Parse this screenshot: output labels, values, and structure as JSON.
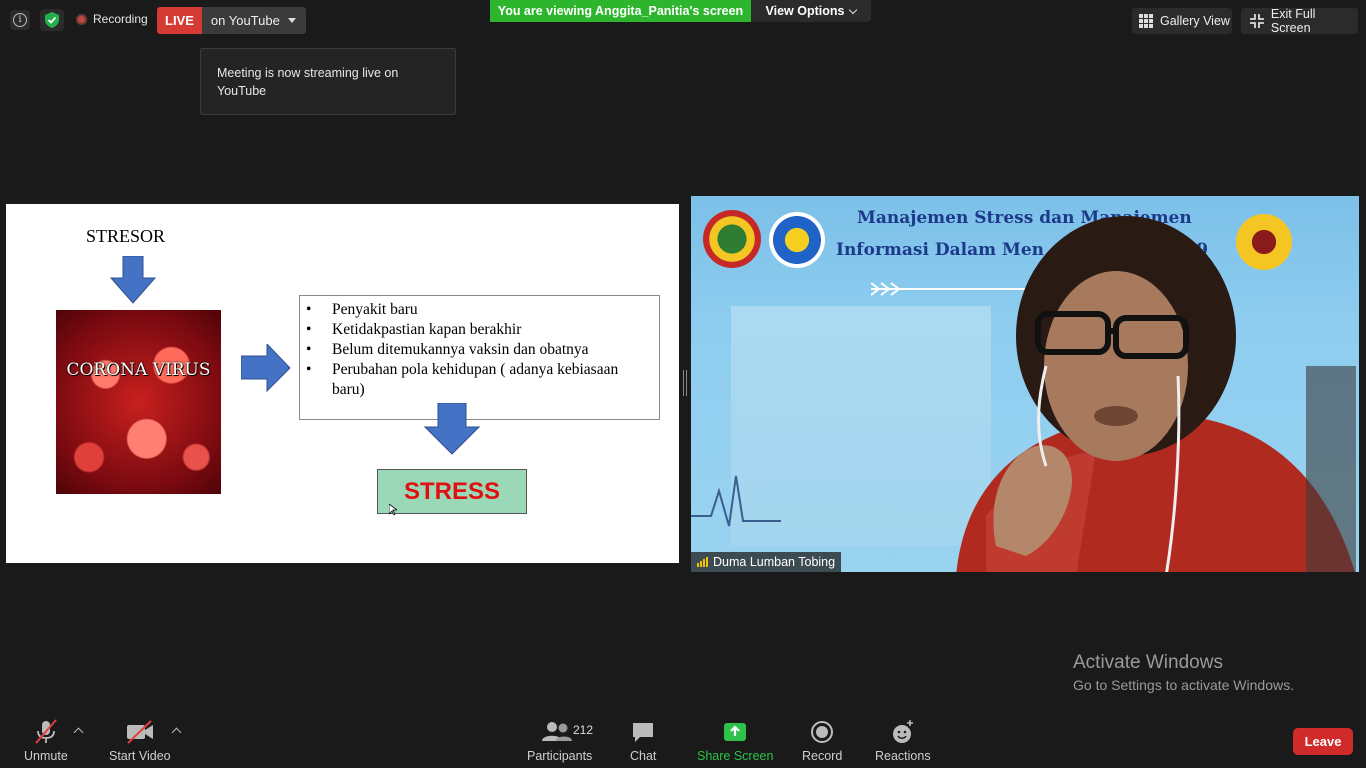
{
  "topbar": {
    "recording_label": "Recording",
    "live_badge": "LIVE",
    "live_destination": "on YouTube",
    "viewing_banner": "You are viewing Anggita_Panitia's screen",
    "view_options": "View Options",
    "gallery_view": "Gallery View",
    "exit_full_screen": "Exit Full Screen"
  },
  "toast": {
    "message": "Meeting is now streaming live on YouTube"
  },
  "slide": {
    "stresor_label": "STRESOR",
    "virus_caption": "CORONA VIRUS",
    "bullets": [
      "Penyakit baru",
      "Ketidakpastian kapan berakhir",
      "Belum ditemukannya vaksin dan obatnya",
      "Perubahan pola kehidupan ( adanya kebiasaan baru)"
    ],
    "result_label": "STRESS",
    "arrow_color": "#4472c4"
  },
  "video": {
    "banner_line1": "Manajemen Stress dan Manajemen",
    "banner_line2": "Informasi Dalam Men",
    "banner_suffix": "id-19",
    "participant_name": "Duma Lumban Tobing"
  },
  "watermark": {
    "line1": "Activate Windows",
    "line2": "Go to Settings to activate Windows."
  },
  "toolbar": {
    "unmute": "Unmute",
    "start_video": "Start Video",
    "participants": "Participants",
    "participants_count": "212",
    "chat": "Chat",
    "share_screen": "Share Screen",
    "record": "Record",
    "reactions": "Reactions",
    "leave": "Leave"
  },
  "colors": {
    "live_red": "#d63a35",
    "viewing_green": "#2db52d",
    "share_green": "#2ec24a",
    "leave_red": "#d02a2a"
  }
}
